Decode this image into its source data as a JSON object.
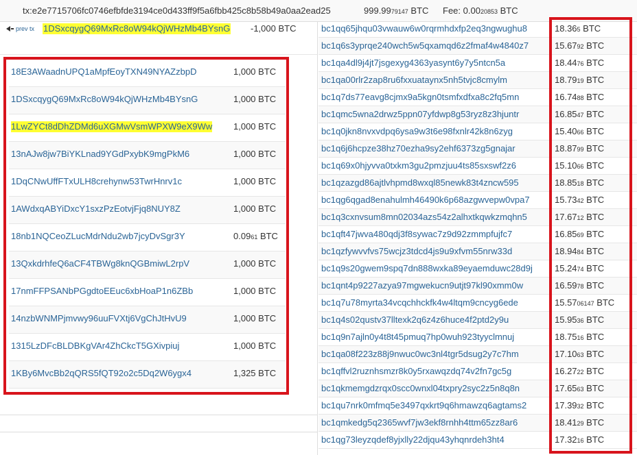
{
  "header": {
    "tx_hash": "tx:e2e7715706fc0746efbfde3194ce0d433ff9f5a6fbb425c8b58b49a0aa2ead25",
    "amount_main": "999.99",
    "amount_small": "79147",
    "amount_unit": " BTC",
    "fee_label": "Fee: ",
    "fee_main": "0.00",
    "fee_small": "20853",
    "fee_unit": " BTC"
  },
  "prev": {
    "link_label": "prev tx",
    "address": "1DSxcqygQ69MxRc8oW94kQjWHzMb4BYsnG",
    "value": "-1,000 BTC"
  },
  "inputs": [
    {
      "address": "18E3AWaadnUPQ1aMpfEoyTXN49NYAZzbpD",
      "value": "1,000 BTC",
      "small": "",
      "unit": "",
      "highlight": false
    },
    {
      "address": "1DSxcqygQ69MxRc8oW94kQjWHzMb4BYsnG",
      "value": "1,000 BTC",
      "small": "",
      "unit": "",
      "highlight": false
    },
    {
      "address": "1LwZYCt8dDhZDMd6uXGMwVsmWPXW9eX9Ww",
      "value": "1,000 BTC",
      "small": "",
      "unit": "",
      "highlight": true
    },
    {
      "address": "13nAJw8jw7BiYKLnad9YGdPxybK9mgPkM6",
      "value": "1,000 BTC",
      "small": "",
      "unit": "",
      "highlight": false
    },
    {
      "address": "1DqCNwUffFTxULH8crehynw53TwrHnrv1c",
      "value": "1,000 BTC",
      "small": "",
      "unit": "",
      "highlight": false
    },
    {
      "address": "1AWdxqABYiDxcY1sxzPzEotvjFjq8NUY8Z",
      "value": "1,000 BTC",
      "small": "",
      "unit": "",
      "highlight": false
    },
    {
      "address": "18nb1NQCeoZLucMdrNdu2wb7jcyDvSgr3Y",
      "value": "0.09",
      "small": "61",
      "unit": " BTC",
      "highlight": false
    },
    {
      "address": "13QxkdrhfeQ6aCF4TBWg8knQGBmiwL2rpV",
      "value": "1,000 BTC",
      "small": "",
      "unit": "",
      "highlight": false
    },
    {
      "address": "17nmFFPSANbPGgdtoEEuc6xbHoaP1n6ZBb",
      "value": "1,000 BTC",
      "small": "",
      "unit": "",
      "highlight": false
    },
    {
      "address": "14nzbWNMPjmvwy96uuFVXtj6VgChJtHvU9",
      "value": "1,000 BTC",
      "small": "",
      "unit": "",
      "highlight": false
    },
    {
      "address": "1315LzDFcBLDBKgVAr4ZhCkcT5GXivpiuj",
      "value": "1,000 BTC",
      "small": "",
      "unit": "",
      "highlight": false
    },
    {
      "address": "1KBy6MvcBb2qQRS5fQT92o2c5Dq2W6ygx4",
      "value": "1,325 BTC",
      "small": "",
      "unit": "",
      "highlight": false
    }
  ],
  "outputs": [
    {
      "address": "bc1qq65jhqu03vwauw6w0rqrmhdxfp2eq3ngwughu8",
      "main": "18.36",
      "small": "5",
      "unit": " BTC"
    },
    {
      "address": "bc1q6s3yprqe240wch5w5qxamqd6z2fmaf4w4840z7",
      "main": "15.67",
      "small": "92",
      "unit": " BTC"
    },
    {
      "address": "bc1qa4dl9j4jt7jsgexyg4363yasynt6y7y5ntcn5a",
      "main": "18.44",
      "small": "76",
      "unit": " BTC"
    },
    {
      "address": "bc1qa00rlr2zap8ru6fxxuataynx5nh5tvjc8cmylm",
      "main": "18.79",
      "small": "19",
      "unit": " BTC"
    },
    {
      "address": "bc1q7ds77eavg8cjmx9a5kgn0tsmfxdfxa8c2fq5mn",
      "main": "16.74",
      "small": "88",
      "unit": " BTC"
    },
    {
      "address": "bc1qmc5wna2drwz5ppn07yfdwp8g53ryz8z3hjuntr",
      "main": "16.85",
      "small": "47",
      "unit": " BTC"
    },
    {
      "address": "bc1q0jkn8nvxvdpq6ysa9w3t6e98fxnlr42k8n6zyg",
      "main": "15.40",
      "small": "66",
      "unit": " BTC"
    },
    {
      "address": "bc1q6j6hcpze38hz70ezha9sy2ehf6373zg5gnajar",
      "main": "18.87",
      "small": "99",
      "unit": " BTC"
    },
    {
      "address": "bc1q69x0hjyvva0txkm3gu2pmzjuu4ts85sxswf2z6",
      "main": "15.10",
      "small": "66",
      "unit": " BTC"
    },
    {
      "address": "bc1qzazgd86ajtlvhpmd8wxql85newk83t4zncw595",
      "main": "18.85",
      "small": "18",
      "unit": " BTC"
    },
    {
      "address": "bc1qg6qgad8enahulmh46490k6p68azgwvepw0vpa7",
      "main": "15.73",
      "small": "42",
      "unit": " BTC"
    },
    {
      "address": "bc1q3cxnvsum8mn02034azs54z2alhxtkqwkzmqhn5",
      "main": "17.67",
      "small": "12",
      "unit": " BTC"
    },
    {
      "address": "bc1qft47jwva480qdj3f8sywac7z9d92zmmpfujfc7",
      "main": "16.85",
      "small": "69",
      "unit": " BTC"
    },
    {
      "address": "bc1qzfywvvfvs75wcjz3tdcd4js9u9xfvm55nrw33d",
      "main": "18.94",
      "small": "84",
      "unit": " BTC"
    },
    {
      "address": "bc1q9s20gwem9spq7dn888wxka89eyaemduwc28d9j",
      "main": "15.24",
      "small": "74",
      "unit": " BTC"
    },
    {
      "address": "bc1qnt4p9227azya97mgwekucn9utjt97kl90xmm0w",
      "main": "16.59",
      "small": "78",
      "unit": " BTC"
    },
    {
      "address": "bc1q7u78myrta34vcqchhckfk4w4ltqm9cncyg6ede",
      "main": "15.57",
      "small": "06147",
      "unit": " BTC"
    },
    {
      "address": "bc1q4s02qustv37lltexk2q6z4z6huce4f2ptd2y9u",
      "main": "15.95",
      "small": "36",
      "unit": " BTC"
    },
    {
      "address": "bc1q9n7ajln0y4t8t45pmuq7hp0wuh923tyyclmnuj",
      "main": "18.75",
      "small": "16",
      "unit": " BTC"
    },
    {
      "address": "bc1qa08f223z88j9nwuc0wc3nl4tgr5dsug2y7c7hm",
      "main": "17.10",
      "small": "63",
      "unit": " BTC"
    },
    {
      "address": "bc1qffvl2ruznhsmzr8k0y5rxawqzdq74v2fn7gc5g",
      "main": "16.27",
      "small": "22",
      "unit": " BTC"
    },
    {
      "address": "bc1qkmemgdzrqx0scc0wnxl04txpry2syc2z5n8q8n",
      "main": "17.65",
      "small": "63",
      "unit": " BTC"
    },
    {
      "address": "bc1qu7nrk0mfmq5e3497qxkrt9q6hmawzq6agtams2",
      "main": "17.39",
      "small": "32",
      "unit": " BTC"
    },
    {
      "address": "bc1qmkedg5q2365wvf7jw3ekf8rnhh4ttm65zz8ar6",
      "main": "18.41",
      "small": "29",
      "unit": " BTC"
    },
    {
      "address": "bc1qg73leyzqdef8yjxlly22djqu43yhqnrdeh3ht4",
      "main": "17.32",
      "small": "16",
      "unit": " BTC"
    }
  ],
  "colors": {
    "link": "#2a6496",
    "highlight": "#ffff33",
    "annotation_box": "#d8141c"
  }
}
